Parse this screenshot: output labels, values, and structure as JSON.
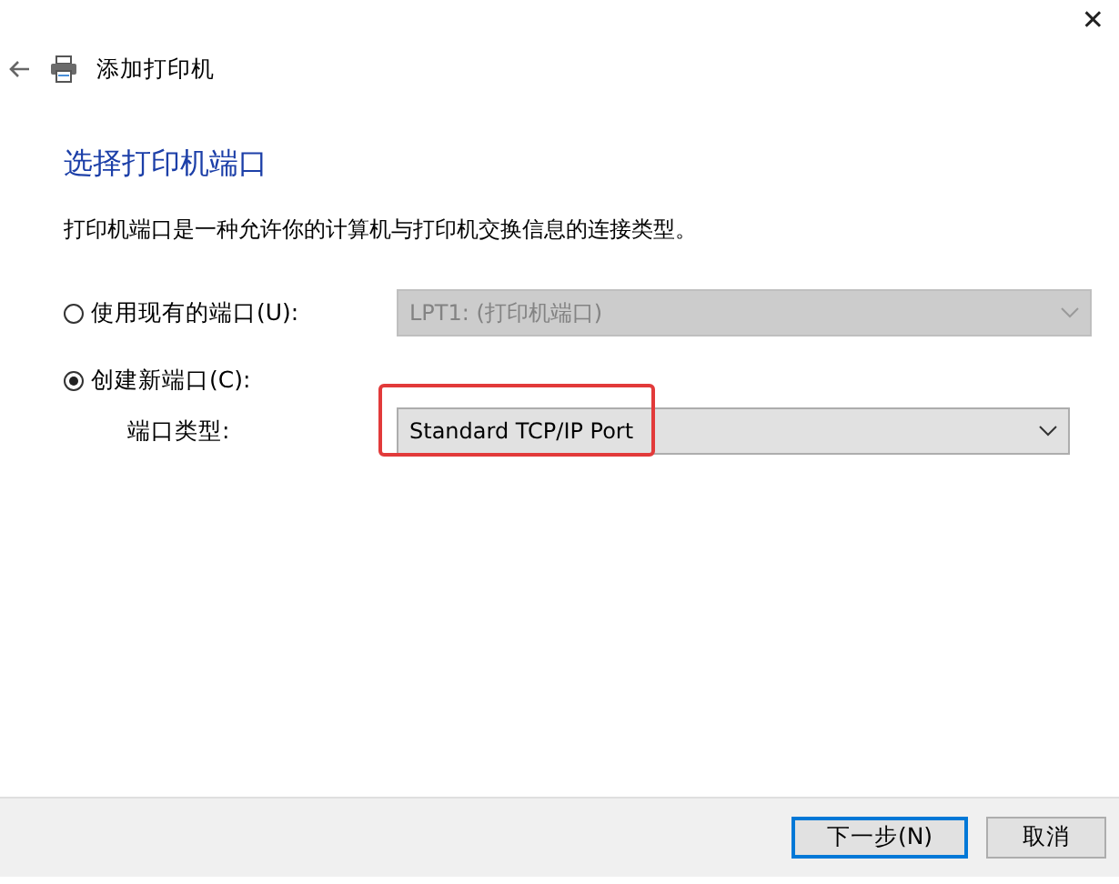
{
  "window": {
    "title": "添加打印机",
    "close_symbol": "✕"
  },
  "heading": "选择打印机端口",
  "description": "打印机端口是一种允许你的计算机与打印机交换信息的连接类型。",
  "options": [
    {
      "label": "使用现有的端口(U):",
      "selected": false,
      "dropdown": {
        "value": "LPT1: (打印机端口)",
        "disabled": true,
        "highlighted": false
      }
    },
    {
      "label": "创建新端口(C):",
      "selected": true
    }
  ],
  "port_type": {
    "label": "端口类型:",
    "dropdown": {
      "value": "Standard TCP/IP Port",
      "disabled": false,
      "highlighted": true
    }
  },
  "buttons": [
    {
      "label": "下一步(N)",
      "default": true
    },
    {
      "label": "取消",
      "default": false
    }
  ]
}
